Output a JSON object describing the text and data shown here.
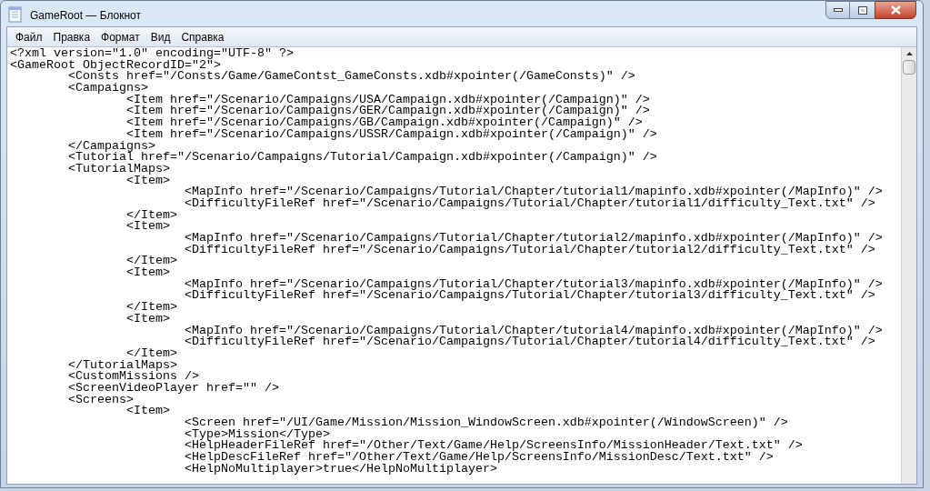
{
  "window": {
    "title": "GameRoot — Блокнот"
  },
  "menu": [
    "Файл",
    "Правка",
    "Формат",
    "Вид",
    "Справка"
  ],
  "lines": [
    "<?xml version=\"1.0\" encoding=\"UTF-8\" ?>",
    "<GameRoot ObjectRecordID=\"2\">",
    "\t<Consts href=\"/Consts/Game/GameContst_GameConsts.xdb#xpointer(/GameConsts)\" />",
    "\t<Campaigns>",
    "\t\t<Item href=\"/Scenario/Campaigns/USA/Campaign.xdb#xpointer(/Campaign)\" />",
    "\t\t<Item href=\"/Scenario/Campaigns/GER/Campaign.xdb#xpointer(/Campaign)\" />",
    "\t\t<Item href=\"/Scenario/Campaigns/GB/Campaign.xdb#xpointer(/Campaign)\" />",
    "\t\t<Item href=\"/Scenario/Campaigns/USSR/Campaign.xdb#xpointer(/Campaign)\" />",
    "\t</Campaigns>",
    "\t<Tutorial href=\"/Scenario/Campaigns/Tutorial/Campaign.xdb#xpointer(/Campaign)\" />",
    "\t<TutorialMaps>",
    "\t\t<Item>",
    "\t\t\t<MapInfo href=\"/Scenario/Campaigns/Tutorial/Chapter/tutorial1/mapinfo.xdb#xpointer(/MapInfo)\" />",
    "\t\t\t<DifficultyFileRef href=\"/Scenario/Campaigns/Tutorial/Chapter/tutorial1/difficulty_Text.txt\" />",
    "\t\t</Item>",
    "\t\t<Item>",
    "\t\t\t<MapInfo href=\"/Scenario/Campaigns/Tutorial/Chapter/tutorial2/mapinfo.xdb#xpointer(/MapInfo)\" />",
    "\t\t\t<DifficultyFileRef href=\"/Scenario/Campaigns/Tutorial/Chapter/tutorial2/difficulty_Text.txt\" />",
    "\t\t</Item>",
    "\t\t<Item>",
    "\t\t\t<MapInfo href=\"/Scenario/Campaigns/Tutorial/Chapter/tutorial3/mapinfo.xdb#xpointer(/MapInfo)\" />",
    "\t\t\t<DifficultyFileRef href=\"/Scenario/Campaigns/Tutorial/Chapter/tutorial3/difficulty_Text.txt\" />",
    "\t\t</Item>",
    "\t\t<Item>",
    "\t\t\t<MapInfo href=\"/Scenario/Campaigns/Tutorial/Chapter/tutorial4/mapinfo.xdb#xpointer(/MapInfo)\" />",
    "\t\t\t<DifficultyFileRef href=\"/Scenario/Campaigns/Tutorial/Chapter/tutorial4/difficulty_Text.txt\" />",
    "\t\t</Item>",
    "\t</TutorialMaps>",
    "\t<CustomMissions />",
    "\t<ScreenVideoPlayer href=\"\" />",
    "\t<Screens>",
    "\t\t<Item>",
    "\t\t\t<Screen href=\"/UI/Game/Mission/Mission_WindowScreen.xdb#xpointer(/WindowScreen)\" />",
    "\t\t\t<Type>Mission</Type>",
    "\t\t\t<HelpHeaderFileRef href=\"/Other/Text/Game/Help/ScreensInfo/MissionHeader/Text.txt\" />",
    "\t\t\t<HelpDescFileRef href=\"/Other/Text/Game/Help/ScreensInfo/MissionDesc/Text.txt\" />",
    "\t\t\t<HelpNoMultiplayer>true</HelpNoMultiplayer>"
  ]
}
